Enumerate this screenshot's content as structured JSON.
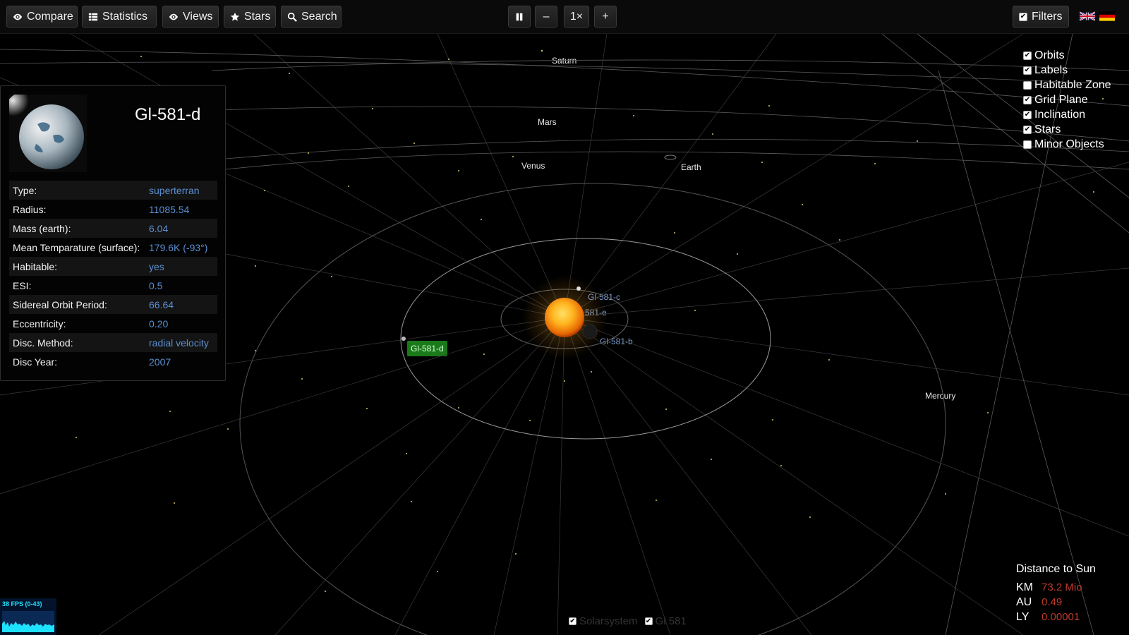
{
  "toolbar": {
    "compare": "Compare",
    "statistics": "Statistics",
    "views": "Views",
    "stars": "Stars",
    "search": "Search",
    "speed_minus": "–",
    "speed_value": "1×",
    "speed_plus": "+",
    "filters": "Filters"
  },
  "scene_labels": {
    "saturn": "Saturn",
    "mars": "Mars",
    "venus": "Venus",
    "earth": "Earth",
    "mercury": "Mercury",
    "gl581c": "Gl-581-c",
    "gl581e": "581-e",
    "gl581b": "Gl-581-b",
    "gl581d": "Gl-581-d"
  },
  "planet": {
    "name": "Gl-581-d",
    "properties": [
      {
        "key": "Type:",
        "value": "superterran"
      },
      {
        "key": "Radius:",
        "value": "11085.54"
      },
      {
        "key": "Mass (earth):",
        "value": "6.04"
      },
      {
        "key": "Mean Temparature (surface):",
        "value": "179.6K (-93°)"
      },
      {
        "key": "Habitable:",
        "value": "yes"
      },
      {
        "key": "ESI:",
        "value": "0.5"
      },
      {
        "key": "Sidereal Orbit Period:",
        "value": "66.64"
      },
      {
        "key": "Eccentricity:",
        "value": "0.20"
      },
      {
        "key": "Disc. Method:",
        "value": "radial velocity"
      },
      {
        "key": "Disc Year:",
        "value": "2007"
      }
    ]
  },
  "filters": [
    {
      "label": "Orbits",
      "checked": true
    },
    {
      "label": "Labels",
      "checked": true
    },
    {
      "label": "Habitable Zone",
      "checked": false
    },
    {
      "label": "Grid Plane",
      "checked": true
    },
    {
      "label": "Inclination",
      "checked": true
    },
    {
      "label": "Stars",
      "checked": true
    },
    {
      "label": "Minor Objects",
      "checked": false
    }
  ],
  "distance": {
    "title": "Distance to Sun",
    "rows": [
      {
        "unit": "KM",
        "value": "73.2 Mio"
      },
      {
        "unit": "AU",
        "value": "0.49"
      },
      {
        "unit": "LY",
        "value": "0.00001"
      }
    ]
  },
  "fps": "38 FPS (0-43)",
  "systems": {
    "solarsystem": "Solarsystem",
    "gl581": "Gl 581"
  },
  "colors": {
    "accent_value": "#5b8fd1",
    "distance_value": "#c0392b",
    "selected_label_bg": "#1a7a1a"
  }
}
